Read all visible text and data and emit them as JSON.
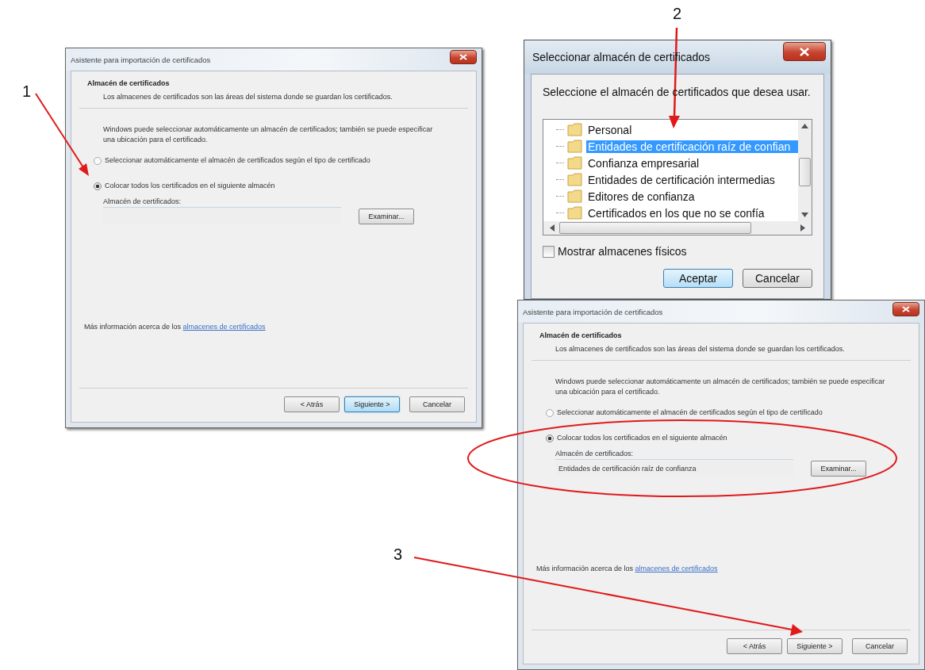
{
  "wizards": [
    {
      "title": "Asistente para importación de certificados",
      "heading": "Almacén de certificados",
      "description": "Los almacenes de certificados son las áreas del sistema donde se guardan los certificados.",
      "instruction": "Windows puede seleccionar automáticamente un almacén de certificados; también se puede especificar una ubicación para el certificado.",
      "options": [
        {
          "label": "Seleccionar automáticamente el almacén de certificados según el tipo de certificado",
          "selected": false
        },
        {
          "label": "Colocar todos los certificados en el siguiente almacén",
          "selected": true
        }
      ],
      "store_label": "Almacén de certificados:",
      "browse": "Examinar...",
      "info": "Más información acerca de los",
      "link": "almacenes de certificados",
      "buttons": [
        {
          "label": "< Atrás",
          "focused": false
        },
        {
          "label": "Siguiente >",
          "focused": true
        },
        {
          "label": "Cancelar",
          "focused": false
        }
      ]
    },
    {
      "title": "Asistente para importación de certificados",
      "heading": "Almacén de certificados",
      "description": "Los almacenes de certificados son las áreas del sistema donde se guardan los certificados.",
      "instruction": "Windows puede seleccionar automáticamente un almacén de certificados; también se puede especificar una ubicación para el certificado.",
      "options": [
        {
          "label": "Seleccionar automáticamente el almacén de certificados según el tipo de certificado",
          "selected": false
        },
        {
          "label": "Colocar todos los certificados en el siguiente almacén",
          "selected": true
        }
      ],
      "store_label": "Almacén de certificados:",
      "store_value": "Entidades de certificación raíz de confianza",
      "browse": "Examinar...",
      "info": "Más información acerca de los",
      "link": "almacenes de certificados",
      "buttons": [
        {
          "label": "< Atrás",
          "focused": false
        },
        {
          "label": "Siguiente >",
          "focused": false
        },
        {
          "label": "Cancelar",
          "focused": false
        }
      ]
    }
  ],
  "store_dialog": {
    "title": "Seleccionar almacén de certificados",
    "prompt": "Seleccione el almacén de certificados que desea usar.",
    "stores": [
      {
        "label": "Personal",
        "selected": false
      },
      {
        "label": "Entidades de certificación raíz de confian",
        "selected": true
      },
      {
        "label": "Confianza empresarial",
        "selected": false
      },
      {
        "label": "Entidades de certificación intermedias",
        "selected": false
      },
      {
        "label": "Editores de confianza",
        "selected": false
      },
      {
        "label": "Certificados en los que no se confía",
        "selected": false
      }
    ],
    "checkbox": {
      "label": "Mostrar almacenes físicos",
      "checked": false
    },
    "buttons": [
      {
        "label": "Aceptar",
        "focused": true
      },
      {
        "label": "Cancelar",
        "focused": false
      }
    ]
  },
  "annotations": [
    {
      "label": "1"
    },
    {
      "label": "2"
    },
    {
      "label": "3"
    }
  ]
}
